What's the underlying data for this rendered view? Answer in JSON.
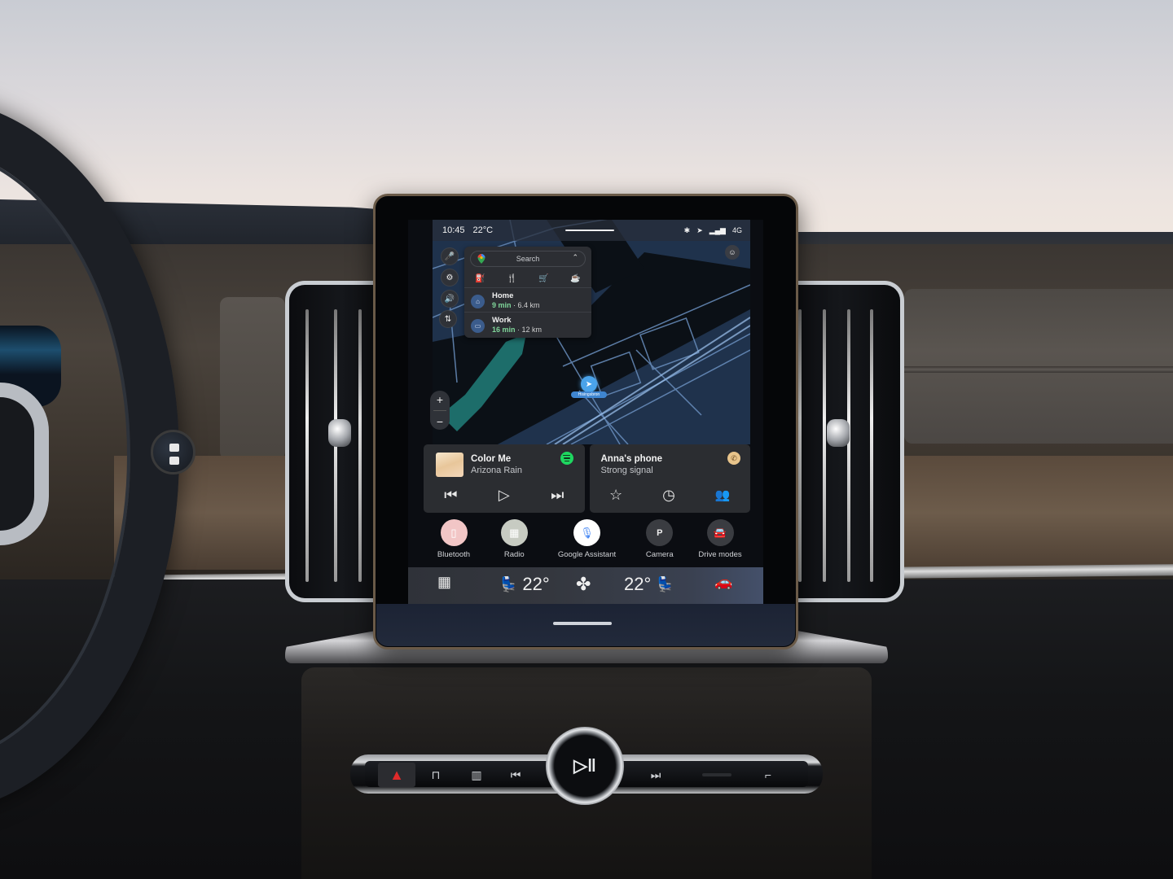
{
  "status_bar": {
    "time": "10:45",
    "outside_temp": "22°C",
    "icons": [
      "bluetooth-icon",
      "location-icon",
      "signal-icon"
    ],
    "network": "4G"
  },
  "map_controls": {
    "left_buttons": [
      {
        "name": "voice-search",
        "glyph": "🎤"
      },
      {
        "name": "settings",
        "glyph": "⚙"
      },
      {
        "name": "volume",
        "glyph": "🔊"
      },
      {
        "name": "route-options",
        "glyph": "⇅"
      }
    ],
    "zoom_in": "+",
    "zoom_out": "−",
    "profile_glyph": "☺",
    "location_label": "Hisingsbron"
  },
  "search_panel": {
    "placeholder": "Search",
    "collapse_glyph": "⌃",
    "categories": [
      {
        "name": "gas-station",
        "glyph": "⛽"
      },
      {
        "name": "restaurants",
        "glyph": "🍴"
      },
      {
        "name": "shopping",
        "glyph": "🛒"
      },
      {
        "name": "cafe",
        "glyph": "☕"
      }
    ],
    "destinations": [
      {
        "name": "Home",
        "minutes": "9 min",
        "distance": "· 6.4 km",
        "glyph": "⌂"
      },
      {
        "name": "Work",
        "minutes": "16 min",
        "distance": "· 12 km",
        "glyph": "▭"
      }
    ]
  },
  "media_card": {
    "track": "Color Me",
    "artist": "Arizona Rain",
    "source": "Spotify",
    "controls": {
      "previous": "⏮",
      "play": "▷",
      "next": "⏭"
    }
  },
  "phone_card": {
    "device": "Anna's phone",
    "status": "Strong signal",
    "controls": {
      "favorites": "☆",
      "recents": "◷",
      "contacts": "👥"
    }
  },
  "dock": [
    {
      "label": "Bluetooth",
      "glyph": "▯",
      "bg": "#f2c6c6",
      "fg": "#ffffff"
    },
    {
      "label": "Radio",
      "glyph": "▦",
      "bg": "#c7cbc2",
      "fg": "#ffffff"
    },
    {
      "label": "Google Assistant",
      "glyph": "🎙",
      "bg": "#ffffff",
      "fg": "#4a8af4"
    },
    {
      "label": "Camera",
      "glyph": "P",
      "bg": "#3a3c41",
      "fg": "#eeeeee"
    },
    {
      "label": "Drive modes",
      "glyph": "🚘",
      "bg": "#3a3c41",
      "fg": "#eeeeee"
    }
  ],
  "climate": {
    "apps_glyph": "▦",
    "driver_temp": "22°",
    "passenger_temp": "22°",
    "fan_glyph": "✤",
    "car_glyph": "🚗"
  },
  "hardware_buttons": {
    "hazard": "▲",
    "front_defrost": "⊓",
    "rear_defrost": "▥",
    "previous": "⏮",
    "play_pause": "▷‖",
    "next": "⏭",
    "seat": "⌐"
  },
  "colors": {
    "accent_green": "#7fd59a",
    "spotify_green": "#1ed760",
    "nav_blue": "#4aa3ea",
    "hazard_red": "#e02a2a"
  }
}
